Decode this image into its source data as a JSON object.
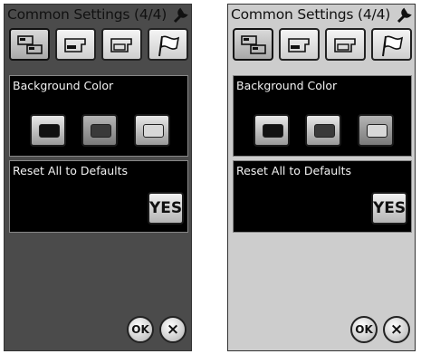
{
  "panels": [
    {
      "theme": "dark",
      "background": "#4b4b4b",
      "title": "Common Settings (4/4)",
      "tabs": [
        "machine-settings-icon",
        "sewing-settings-icon",
        "embroidery-settings-icon",
        "flag-icon"
      ],
      "background_color": {
        "label": "Background Color",
        "options": [
          {
            "name": "black",
            "color": "#111111",
            "selected": false
          },
          {
            "name": "dark-gray",
            "color": "#3a3a3a",
            "selected": true
          },
          {
            "name": "light-gray",
            "color": "#d8d8d8",
            "selected": false
          }
        ]
      },
      "reset": {
        "label": "Reset All to Defaults",
        "button": "YES"
      },
      "ok_label": "OK",
      "cancel_label": "×"
    },
    {
      "theme": "light",
      "background": "#cdcdcd",
      "title": "Common Settings (4/4)",
      "tabs": [
        "machine-settings-icon",
        "sewing-settings-icon",
        "embroidery-settings-icon",
        "flag-icon"
      ],
      "background_color": {
        "label": "Background Color",
        "options": [
          {
            "name": "black",
            "color": "#111111",
            "selected": false
          },
          {
            "name": "dark-gray",
            "color": "#3a3a3a",
            "selected": false
          },
          {
            "name": "light-gray",
            "color": "#d8d8d8",
            "selected": true
          }
        ]
      },
      "reset": {
        "label": "Reset All to Defaults",
        "button": "YES"
      },
      "ok_label": "OK",
      "cancel_label": "×"
    }
  ]
}
